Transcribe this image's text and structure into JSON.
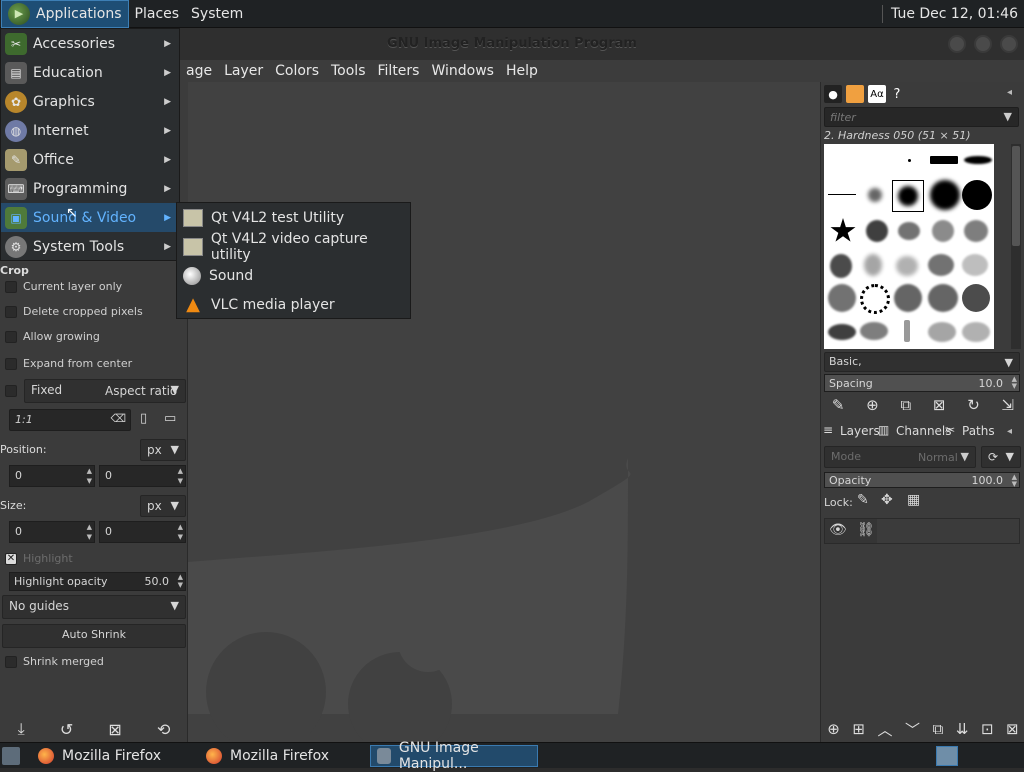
{
  "top_panel": {
    "applications": "Applications",
    "places": "Places",
    "system": "System",
    "clock": "Tue Dec 12, 01:46"
  },
  "window": {
    "title": "GNU Image Manipulation Program"
  },
  "menubar": {
    "items": [
      "age",
      "Layer",
      "Colors",
      "Tools",
      "Filters",
      "Windows",
      "Help"
    ]
  },
  "apps_menu": {
    "items": [
      {
        "label": "Accessories",
        "icon": "accessories-icon"
      },
      {
        "label": "Education",
        "icon": "education-icon"
      },
      {
        "label": "Graphics",
        "icon": "graphics-icon"
      },
      {
        "label": "Internet",
        "icon": "internet-icon"
      },
      {
        "label": "Office",
        "icon": "office-icon"
      },
      {
        "label": "Programming",
        "icon": "programming-icon"
      },
      {
        "label": "Sound & Video",
        "icon": "sound-video-icon"
      },
      {
        "label": "System Tools",
        "icon": "system-tools-icon"
      }
    ],
    "active": "Sound & Video"
  },
  "sub_menu": {
    "items": [
      {
        "label": "Qt V4L2 test Utility",
        "icon": "qt-v4l2-icon"
      },
      {
        "label": "Qt V4L2 video capture utility",
        "icon": "qt-v4l2-capture-icon"
      },
      {
        "label": "Sound",
        "icon": "sound-icon"
      },
      {
        "label": "VLC media player",
        "icon": "vlc-icon"
      }
    ]
  },
  "tool_options": {
    "title": "Crop",
    "current_layer_only": "Current layer only",
    "delete_cropped": "Delete cropped pixels",
    "allow_growing": "Allow growing",
    "expand_from_center": "Expand from center",
    "fixed": "Fixed",
    "aspect_ratio": "Aspect ratio",
    "ratio_value": "1:1",
    "position_label": "Position:",
    "position_unit": "px",
    "position_x": "0",
    "position_y": "0",
    "size_label": "Size:",
    "size_unit": "px",
    "size_w": "0",
    "size_h": "0",
    "highlight": "Highlight",
    "highlight_opacity_label": "Highlight opacity",
    "highlight_opacity_value": "50.0",
    "guides": "No guides",
    "auto_shrink": "Auto Shrink",
    "shrink_merged": "Shrink merged"
  },
  "brushes": {
    "filter_placeholder": "filter",
    "selected": "2. Hardness 050 (51 × 51)",
    "preset": "Basic,",
    "spacing_label": "Spacing",
    "spacing_value": "10.0"
  },
  "layers": {
    "tab_layers": "Layers",
    "tab_channels": "Channels",
    "tab_paths": "Paths",
    "mode_label": "Mode",
    "mode_value": "Normal",
    "opacity_label": "Opacity",
    "opacity_value": "100.0",
    "lock_label": "Lock:"
  },
  "taskbar": {
    "tasks": [
      {
        "label": "Mozilla Firefox"
      },
      {
        "label": "Mozilla Firefox"
      },
      {
        "label": "GNU Image Manipul..."
      }
    ]
  }
}
